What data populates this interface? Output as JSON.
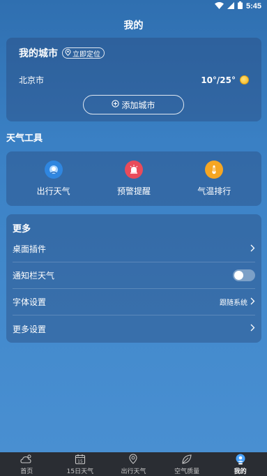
{
  "status_bar": {
    "time": "5:45",
    "icons": [
      "wifi-icon",
      "signal-icon",
      "battery-icon"
    ]
  },
  "page_title": "我的",
  "my_city": {
    "title": "我的城市",
    "locate_label": "立即定位",
    "cities": [
      {
        "name": "北京市",
        "temp": "10°/25°",
        "weather_icon": "sunny-icon"
      }
    ],
    "add_city_label": "添加城市"
  },
  "weather_tools": {
    "title": "天气工具",
    "items": [
      {
        "label": "出行天气",
        "icon": "travel-pin-icon",
        "color": "#2f86e0"
      },
      {
        "label": "预警提醒",
        "icon": "alarm-icon",
        "color": "#e94b5a"
      },
      {
        "label": "气温排行",
        "icon": "thermometer-icon",
        "color": "#f5a623"
      }
    ]
  },
  "more": {
    "title": "更多",
    "rows": [
      {
        "label": "桌面插件"
      },
      {
        "label": "通知栏天气",
        "toggle": false
      },
      {
        "label": "字体设置",
        "value": "跟随系统"
      },
      {
        "label": "更多设置"
      }
    ]
  },
  "tab_bar": {
    "tabs": [
      {
        "label": "首页",
        "icon": "home-weather-icon",
        "active": false
      },
      {
        "label": "15日天气",
        "icon": "calendar-15-icon",
        "active": false
      },
      {
        "label": "出行天气",
        "icon": "location-pin-icon",
        "active": false
      },
      {
        "label": "空气质量",
        "icon": "leaf-icon",
        "active": false
      },
      {
        "label": "我的",
        "icon": "profile-icon",
        "active": true
      }
    ]
  }
}
